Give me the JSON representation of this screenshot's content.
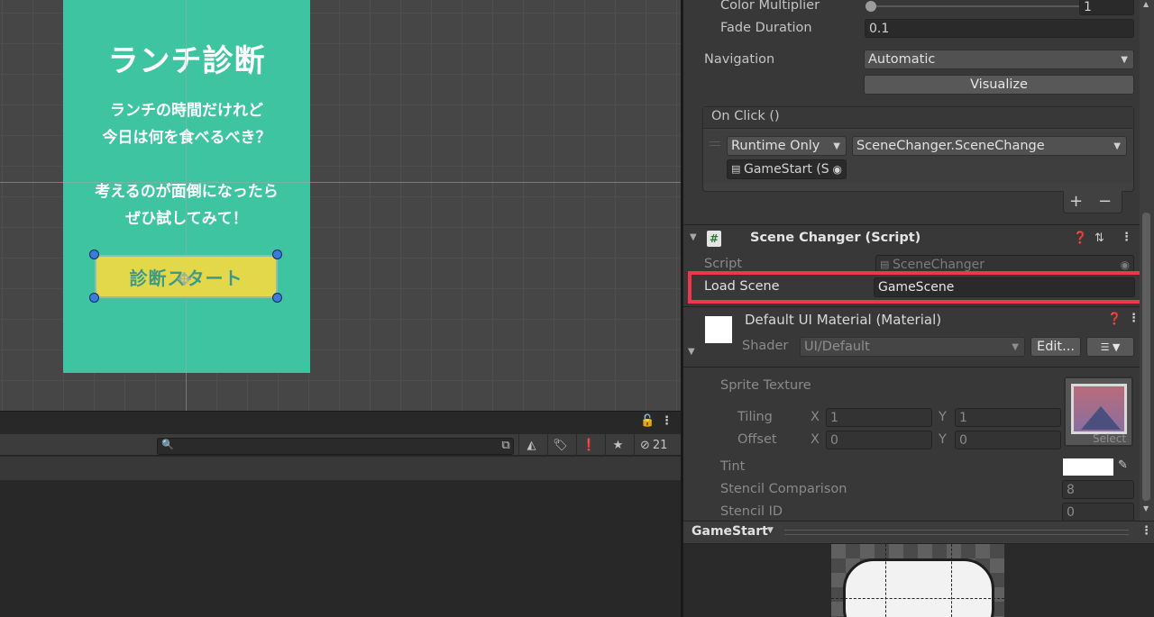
{
  "scene": {
    "title": "ランチ診断",
    "lines": [
      "ランチの時間だけれど",
      "今日は何を食べるべき？",
      "考えるのが面倒になったら",
      "ぜひ試してみて！"
    ],
    "button_label": "診断スタート"
  },
  "project_toolbar": {
    "hidden_count": "21"
  },
  "inspector": {
    "color_multiplier_label": "Color Multiplier",
    "color_multiplier_value": "1",
    "fade_duration_label": "Fade Duration",
    "fade_duration_value": "0.1",
    "navigation_label": "Navigation",
    "navigation_value": "Automatic",
    "visualize_label": "Visualize",
    "onclick_header": "On Click ()",
    "runtime_value": "Runtime Only",
    "function_value": "SceneChanger.SceneChange",
    "target_object": "GameStart (S",
    "add_symbol": "+",
    "remove_symbol": "−",
    "scene_changer_title": "Scene Changer (Script)",
    "script_label": "Script",
    "script_value": "SceneChanger",
    "load_scene_label": "Load Scene",
    "load_scene_value": "GameScene",
    "material_title": "Default UI Material (Material)",
    "shader_label": "Shader",
    "shader_value": "UI/Default",
    "edit_label": "Edit...",
    "sprite_texture_label": "Sprite Texture",
    "tiling_label": "Tiling",
    "offset_label": "Offset",
    "x_label": "X",
    "y_label": "Y",
    "tiling_x": "1",
    "tiling_y": "1",
    "offset_x": "0",
    "offset_y": "0",
    "select_label": "Select",
    "tint_label": "Tint",
    "stencil_comparison_label": "Stencil Comparison",
    "stencil_comparison_value": "8",
    "stencil_id_label": "Stencil ID",
    "stencil_id_value": "0"
  },
  "preview": {
    "object_name": "GameStart"
  },
  "colors": {
    "canvas_bg": "#3ec4a0",
    "button_bg": "#e2d84a",
    "highlight": "#f0364a"
  }
}
